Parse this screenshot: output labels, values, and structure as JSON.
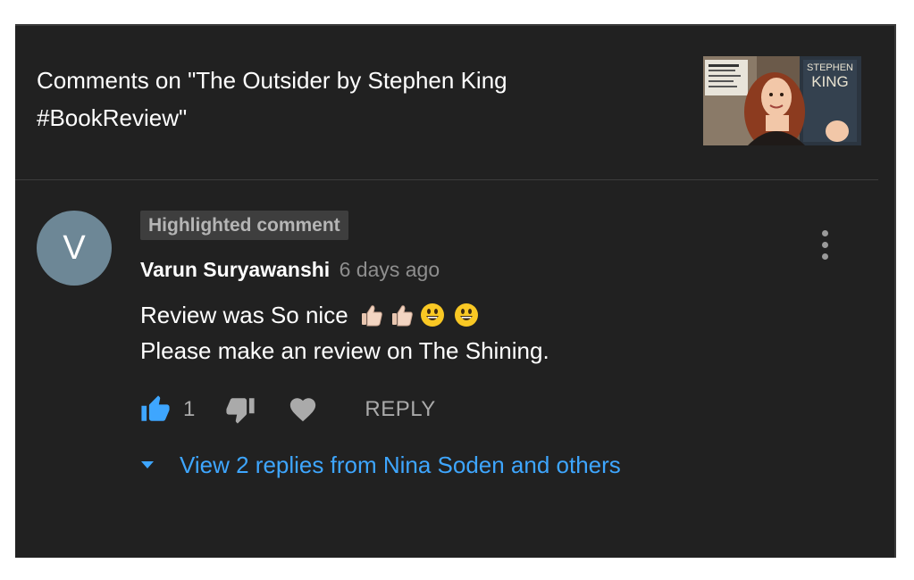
{
  "header": {
    "title": "Comments on \"The Outsider by Stephen King #BookReview\"",
    "thumbnail": {
      "book_text": "STEPHEN KING"
    }
  },
  "comment": {
    "badge": "Highlighted comment",
    "avatar_letter": "V",
    "author": "Varun Suryawanshi",
    "time": "6 days ago",
    "line1": "Review was So nice",
    "line1_emoji": [
      "thumbs-up-emoji",
      "thumbs-up-emoji",
      "grinning-face-emoji",
      "grinning-face-emoji"
    ],
    "line2": "Please make an review on The Shining.",
    "like_count": "1",
    "reply_label": "REPLY",
    "view_replies": "View 2 replies from Nina Soden and others"
  },
  "colors": {
    "background": "#212121",
    "link": "#3ea6ff",
    "avatar": "#6d8796"
  }
}
